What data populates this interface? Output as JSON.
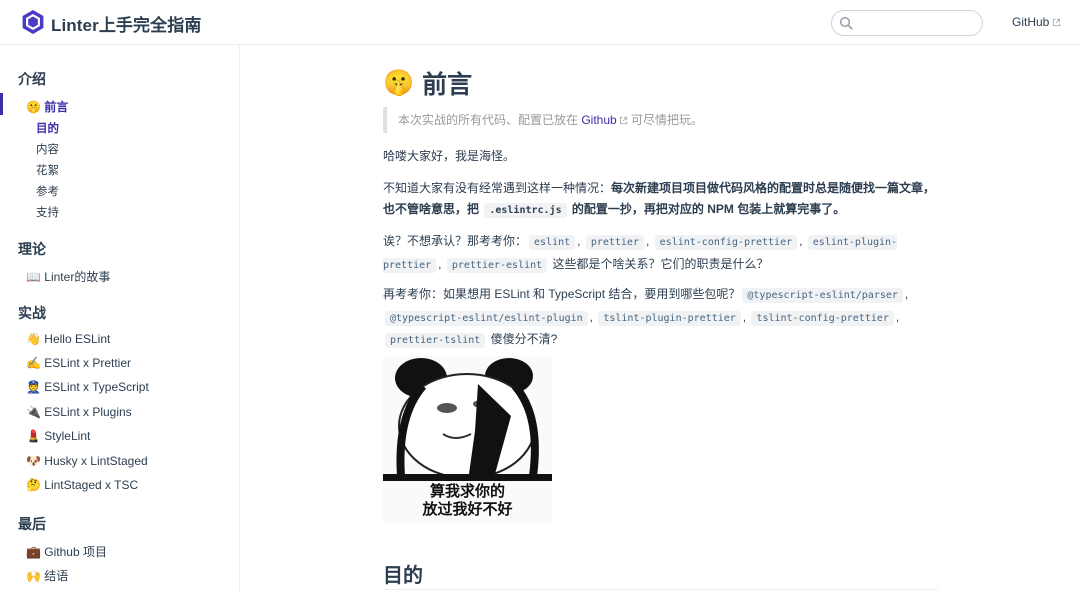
{
  "nav": {
    "title": "Linter上手完全指南",
    "search_value": "",
    "github_label": "GitHub",
    "brand_color": "#3b2fa8"
  },
  "sidebar": {
    "groups": [
      {
        "title": "介绍",
        "items": [
          {
            "label": "前言",
            "icon": "shushing-face-emoji",
            "active": true,
            "children": [
              "目的",
              "内容",
              "花絮",
              "参考",
              "支持"
            ]
          }
        ]
      },
      {
        "title": "理论",
        "items": [
          {
            "label": "Linter的故事",
            "icon": "book-emoji"
          }
        ]
      },
      {
        "title": "实战",
        "items": [
          {
            "label": "Hello ESLint",
            "icon": "waving-hand-emoji"
          },
          {
            "label": "ESLint x Prettier",
            "icon": "writing-hand-emoji"
          },
          {
            "label": "ESLint x TypeScript",
            "icon": "police-officer-emoji"
          },
          {
            "label": "ESLint x Plugins",
            "icon": "plug-emoji"
          },
          {
            "label": "StyleLint",
            "icon": "lipstick-emoji"
          },
          {
            "label": "Husky x LintStaged",
            "icon": "dog-face-emoji"
          },
          {
            "label": "LintStaged x TSC",
            "icon": "thinking-face-emoji"
          }
        ]
      },
      {
        "title": "最后",
        "items": [
          {
            "label": "Github 项目",
            "icon": "briefcase-emoji"
          },
          {
            "label": "结语",
            "icon": "raising-hands-emoji"
          }
        ]
      }
    ]
  },
  "main": {
    "title": "前言",
    "title_icon": "shushing-face-emoji",
    "quote_before": "本次实战的所有代码、配置已放在 ",
    "quote_link": "Github",
    "quote_after": " 可尽情把玩。",
    "p1": "哈喽大家好，我是海怪。",
    "p2_before": "不知道大家有没有经常遇到这样一种情况：",
    "p2_bold_1": "每次新建项目项目做代码风格的配置时总是随便找一篇文章，也不管啥意思，把 ",
    "p2_code": ".eslintrc.js",
    "p2_bold_2": " 的配置一抄，再把对应的 NPM 包装上就算完事了。",
    "p3_before": "诶？不想承认？那考考你：",
    "p3_codes": [
      "eslint",
      "prettier",
      "eslint-config-prettier",
      "eslint-plugin-prettier",
      "prettier-eslint"
    ],
    "p3_after": " 这些都是个啥关系？它们的职责是什么？",
    "p4_before": "再考考你：如果想用 ESLint 和 TypeScript 结合，要用到哪些包呢？",
    "p4_codes": [
      "@typescript-eslint/parser",
      "@typescript-eslint/eslint-plugin",
      "tslint-plugin-prettier",
      "tslint-config-prettier",
      "prettier-tslint"
    ],
    "p4_after": " 傻傻分不清?",
    "meme_caption_line1": "算我求你的",
    "meme_caption_line2": "放过我好不好",
    "h2": "目的"
  }
}
